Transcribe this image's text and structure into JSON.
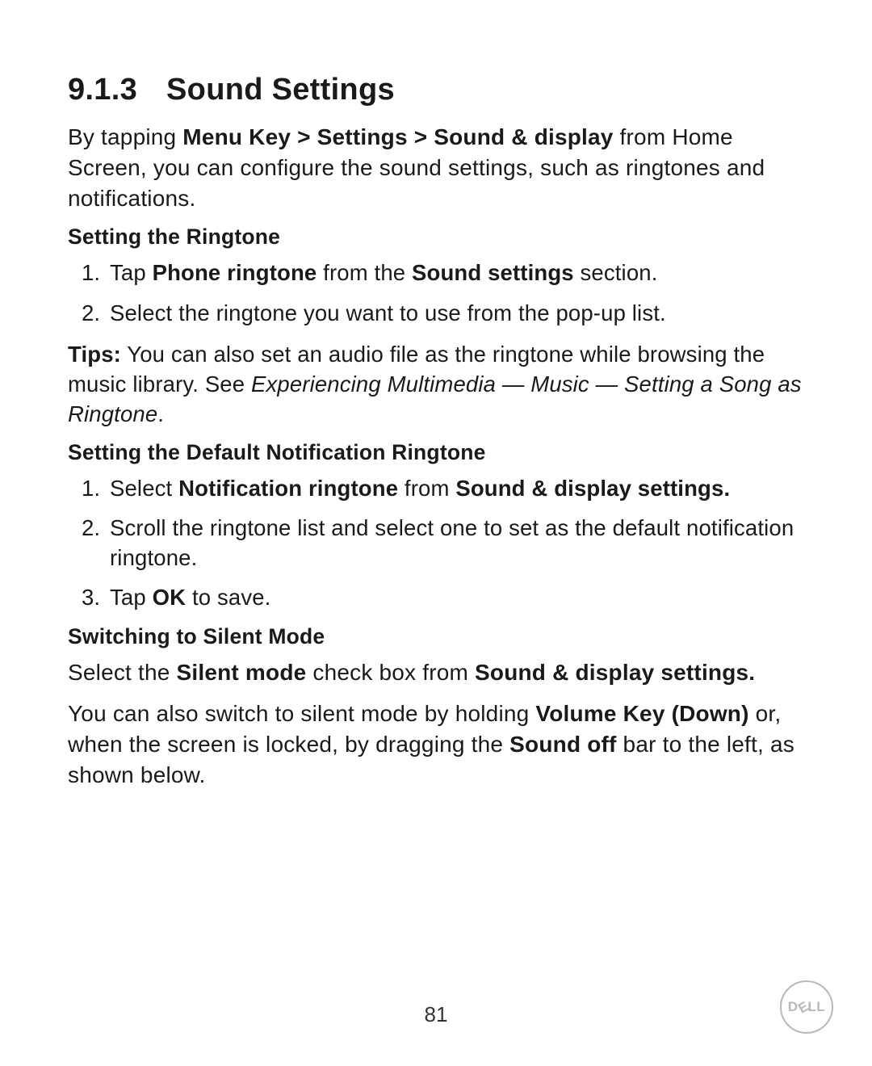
{
  "heading": {
    "number": "9.1.3",
    "title": "Sound Settings"
  },
  "intro": {
    "t0": "By tapping ",
    "b0": "Menu Key > Settings > Sound & display",
    "t1": " from Home Screen, you can configure the sound settings, such as ringtones and notifications."
  },
  "sec1": {
    "heading": "Setting the Ringtone",
    "li1": {
      "t0": "Tap ",
      "b0": "Phone ringtone",
      "t1": " from the ",
      "b1": "Sound settings",
      "t2": " section."
    },
    "li2": {
      "t0": "Select the ringtone you want to use from the pop-up list."
    }
  },
  "tips": {
    "label": "Tips:",
    "t0": " You can also set an audio file as the ringtone while browsing the music library. See ",
    "i0": "Experiencing Multimedia — Music — Setting a Song as Ringtone",
    "t1": "."
  },
  "sec2": {
    "heading": "Setting the Default Notification Ringtone",
    "li1": {
      "t0": "Select ",
      "b0": "Notification ringtone",
      "t1": " from ",
      "b1": "Sound & display settings."
    },
    "li2": {
      "t0": "Scroll the ringtone list and select one to set as the default notification ringtone."
    },
    "li3": {
      "t0": "Tap ",
      "b0": "OK",
      "t1": " to save."
    }
  },
  "sec3": {
    "heading": "Switching to Silent Mode",
    "p1": {
      "t0": "Select the ",
      "b0": "Silent mode",
      "t1": " check box from ",
      "b1": "Sound & display settings."
    },
    "p2": {
      "t0": "You can also switch to silent mode by holding ",
      "b0": "Volume Key (Down)",
      "t1": " or, when the screen is locked, by dragging the ",
      "b1": "Sound off",
      "t2": " bar to the left, as shown below."
    }
  },
  "page_number": "81",
  "logo_text": {
    "d": "D",
    "e": "E",
    "ll": "LL"
  }
}
